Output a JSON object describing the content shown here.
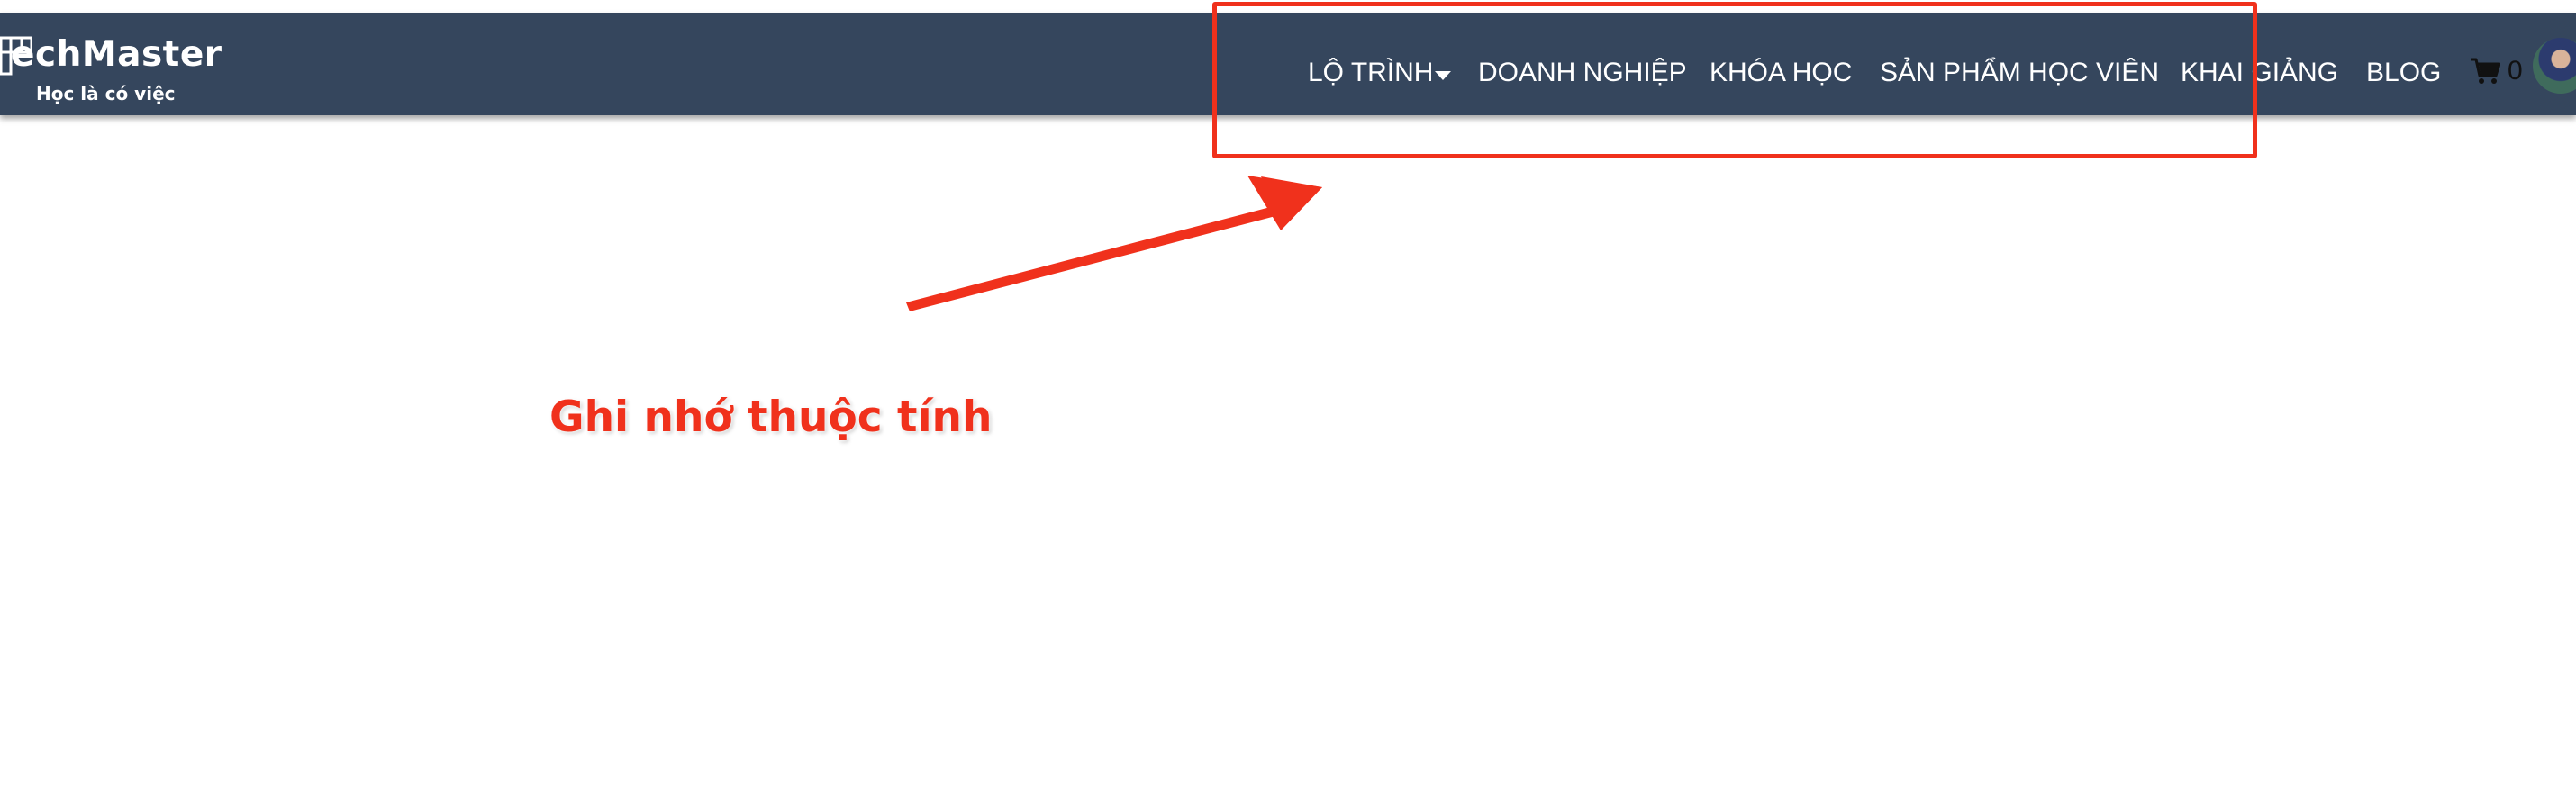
{
  "brand": {
    "name": "echMaster",
    "tagline": "Học là có việc"
  },
  "nav": {
    "items": [
      {
        "label": "LỘ TRÌNH",
        "has_dropdown": true
      },
      {
        "label": "DOANH NGHIỆP"
      },
      {
        "label": "KHÓA HỌC"
      },
      {
        "label": "SẢN PHẨM HỌC VIÊN"
      },
      {
        "label": "KHAI GIẢNG"
      },
      {
        "label": "BLOG"
      }
    ],
    "cart_count": "0",
    "icons": {
      "dropdown": "caret-down-icon",
      "cart": "shopping-cart-icon",
      "avatar": "user-avatar"
    }
  },
  "annotation": {
    "text": "Ghi nhớ thuộc tính",
    "color": "#f0311c"
  },
  "colors": {
    "navbar_bg": "#35465d",
    "nav_text": "#ffffff",
    "page_bg": "#ffffff"
  }
}
